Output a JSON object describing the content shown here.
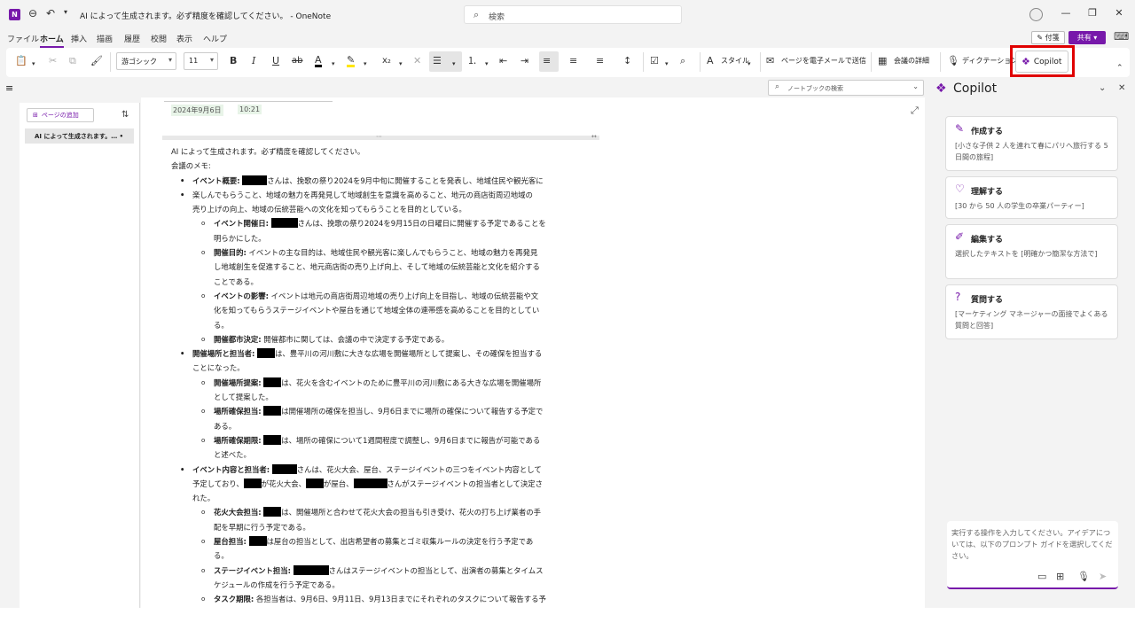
{
  "titlebar": {
    "app_letter": "N",
    "title": "AI によって生成されます。必ず精度を確認してください。 - OneNote",
    "search": "検索"
  },
  "menu": {
    "items": [
      "ファイル",
      "ホーム",
      "挿入",
      "描画",
      "履歴",
      "校閲",
      "表示",
      "ヘルプ"
    ],
    "active": "ホーム",
    "notify": "付箋",
    "share": "共有"
  },
  "ribbon": {
    "font_name": "游ゴシック",
    "font_size": "11",
    "style_label": "スタイル",
    "email_label": "ページを電子メールで送信",
    "meeting_label": "会議の詳細",
    "dictation_label": "ディクテーション",
    "copilot_label": "Copilot"
  },
  "notebook_search": "ノートブックの検索",
  "sidebar": {
    "add_page": "ページの追加",
    "page_item": "AI によって生成されます。…"
  },
  "note": {
    "date": "2024年9月6日",
    "time": "10:21",
    "intro": "AI によって生成されます。必ず精度を確認してください。",
    "memo": "会議のメモ:",
    "s1_key": "イベント概要:",
    "s1_t1": "さんは、挽歌の祭り2024を9月中旬に開催することを発表し、地域住民や観光客に",
    "s1_t2": "楽しんでもらうこと、地域の魅力を再発見して地域創生を意識を高めること、地元の商店街周辺地域の",
    "s1_t3": "売り上げの向上、地域の伝統芸能への文化を知ってもらうことを目的としている。",
    "s1a_key": "イベント開催日:",
    "s1a_t1": "さんは、挽歌の祭り2024を9月15日の日曜日に開催する予定であることを",
    "s1a_t2": "明らかにした。",
    "s1b_key": "開催目的:",
    "s1b_t1": "イベントの主な目的は、地域住民や観光客に楽しんでもらうこと、地域の魅力を再発見",
    "s1b_t2": "し地域創生を促進すること、地元商店街の売り上げ向上、そして地域の伝統芸能と文化を紹介する",
    "s1b_t3": "ことである。",
    "s1c_key": "イベントの影響:",
    "s1c_t1": "イベントは地元の商店街周辺地域の売り上げ向上を目指し、地域の伝統芸能や文",
    "s1c_t2": "化を知ってもらうステージイベントや屋台を通じて地域全体の連帯感を高めることを目的としてい",
    "s1c_t3": "る。",
    "s1d_key": "開催都市決定:",
    "s1d_t1": "開催都市に関しては、会議の中で決定する予定である。",
    "s2_key": "開催場所と担当者:",
    "s2_t1": "は、豊平川の河川敷に大きな広場を開催場所として提案し、その確保を担当する",
    "s2_t2": "ことになった。",
    "s2a_key": "開催場所提案:",
    "s2a_t1": "は、花火を含むイベントのために豊平川の河川敷にある大きな広場を開催場所",
    "s2a_t2": "として提案した。",
    "s2b_key": "場所確保担当:",
    "s2b_t1": "は開催場所の確保を担当し、9月6日までに場所の確保について報告する予定で",
    "s2b_t2": "ある。",
    "s2c_key": "場所確保期限:",
    "s2c_t1": "は、場所の確保について1週間程度で調整し、9月6日までに報告が可能である",
    "s2c_t2": "と述べた。",
    "s3_key": "イベント内容と担当者:",
    "s3_t1": "さんは、花火大会、屋台、ステージイベントの三つをイベント内容として",
    "s3_t2a": "予定しており、",
    "s3_t2b": "が花火大会、",
    "s3_t2c": "が屋台、",
    "s3_t2d": "さんがステージイベントの担当者として決定さ",
    "s3_t3": "れた。",
    "s3a_key": "花火大会担当:",
    "s3a_t1": "は、開催場所と合わせて花火大会の担当も引き受け、花火の打ち上げ業者の手",
    "s3a_t2": "配を早期に行う予定である。",
    "s3b_key": "屋台担当:",
    "s3b_t1": "は屋台の担当として、出店希望者の募集とゴミ収集ルールの決定を行う予定であ",
    "s3b_t2": "る。",
    "s3c_key": "ステージイベント担当:",
    "s3c_t1": "さんはステージイベントの担当として、出演者の募集とタイムス",
    "s3c_t2": "ケジュールの作成を行う予定である。",
    "s3d_key": "タスク期限:",
    "s3d_t1": "各担当者は、9月6日、9月11日、9月13日までにそれぞれのタスクについて報告する予"
  },
  "copilot": {
    "title": "Copilot",
    "cards": [
      {
        "title": "作成する",
        "desc": "[小さな子供 2 人を連れて春にパリへ旅行する 5 日間の旅程]"
      },
      {
        "title": "理解する",
        "desc": "[30 から 50 人の学生の卒業パーティー]"
      },
      {
        "title": "編集する",
        "desc": "選択したテキストを [明確かつ簡潔な方法で]"
      },
      {
        "title": "質問する",
        "desc": "[マーケティング マネージャーの面接でよくある質問と回答]"
      }
    ],
    "input_placeholder": "実行する操作を入力してください。アイデアについては、以下のプロンプト ガイドを選択してください。"
  }
}
